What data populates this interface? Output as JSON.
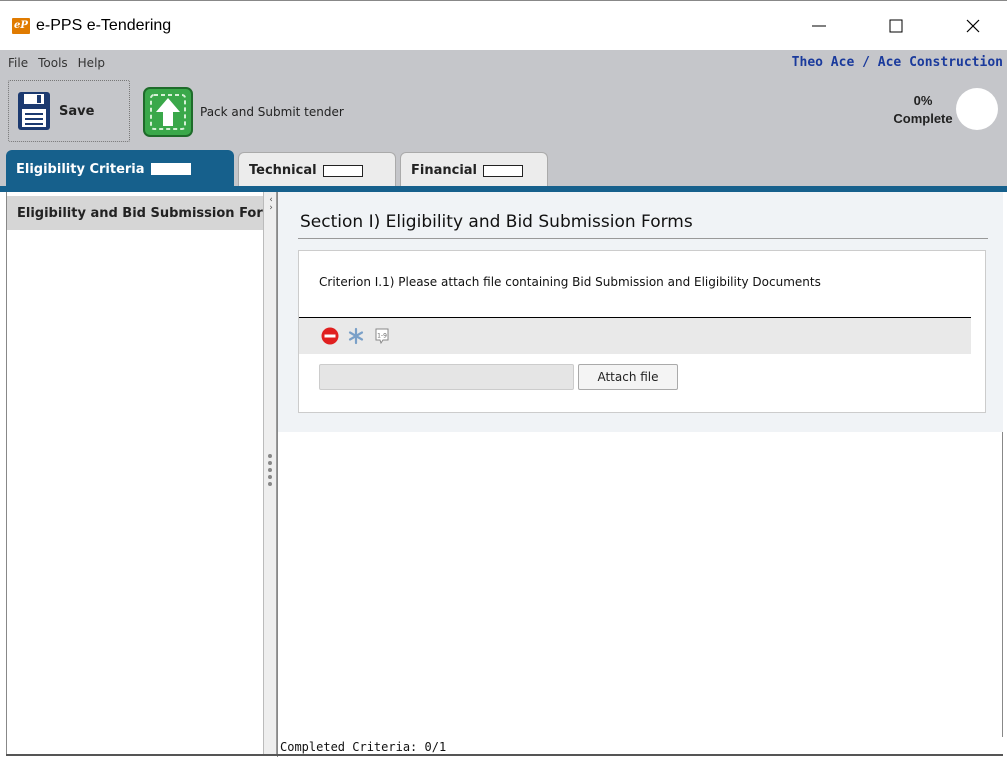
{
  "window": {
    "app_icon_text": "eP",
    "title": "e-PPS e-Tendering",
    "minimize_icon": "minimize-icon",
    "maximize_icon": "maximize-icon",
    "close_icon": "close-icon"
  },
  "menu": {
    "items": [
      "File",
      "Tools",
      "Help"
    ]
  },
  "user": {
    "label": "Theo Ace / Ace Construction"
  },
  "toolbar": {
    "save_label": "Save",
    "submit_label": "Pack and Submit tender"
  },
  "progress": {
    "percent_text": "0%",
    "complete_text": "Complete",
    "value": 0
  },
  "tabs": [
    {
      "label": "Eligibility Criteria",
      "active": true
    },
    {
      "label": "Technical",
      "active": false
    },
    {
      "label": "Financial",
      "active": false
    }
  ],
  "sidebar": {
    "items": [
      {
        "label": "Eligibility and Bid Submission Forms",
        "status_icon": "no-entry-icon"
      }
    ]
  },
  "section": {
    "title": "Section I) Eligibility and Bid Submission Forms",
    "criterion_text": "Criterion I.1) Please attach file containing Bid Submission and Eligibility Documents",
    "icons": [
      "no-entry-icon",
      "asterisk-icon",
      "numbering-icon"
    ],
    "file_value": "",
    "attach_label": "Attach file"
  },
  "status": {
    "completed_text": "Completed Criteria: 0/1"
  },
  "colors": {
    "tab_active": "#16608c",
    "toolbar_bg": "#c5c6ca",
    "user_label": "#1a3a9c",
    "status_red": "#e02020",
    "save_green": "#2e9e3e"
  }
}
